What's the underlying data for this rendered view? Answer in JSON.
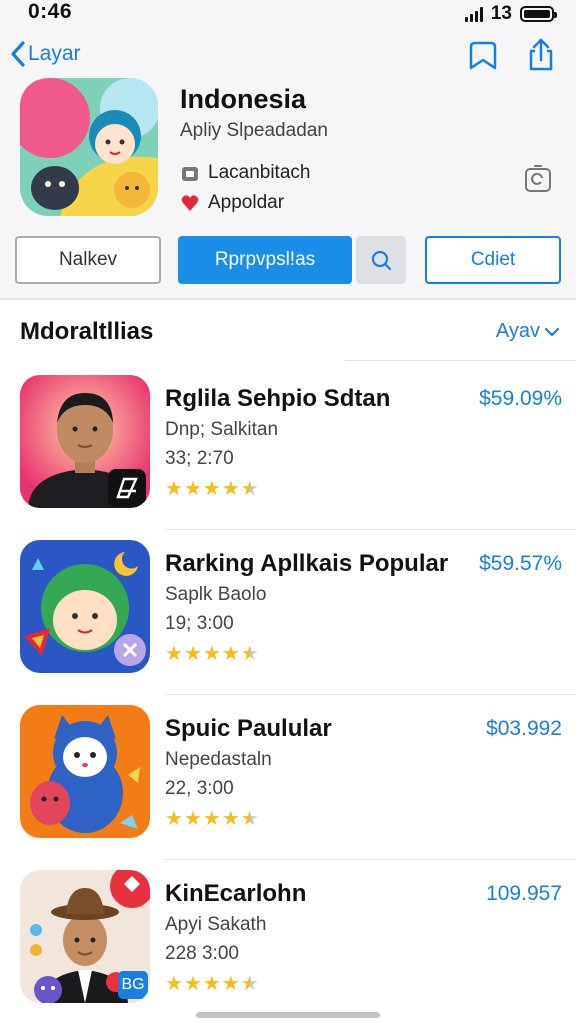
{
  "status_bar": {
    "time": "0:46",
    "signal_label": "13"
  },
  "header": {
    "back_label": "Layar",
    "app_title": "Indonesia",
    "app_subtitle": "Apliy Slpeadadan",
    "meta_1": "Lacanbitach",
    "meta_2": "Appoldar"
  },
  "buttons": {
    "secondary": "Nalkev",
    "primary": "Rprpvpsl!as",
    "tertiary": "Cdiet"
  },
  "section": {
    "title": "Mdoraltllias",
    "action": "Ayav"
  },
  "items": [
    {
      "name": "Rglila Sehpio Sdtan",
      "developer": "Dnp; Salkitan",
      "time": "33; 2:70",
      "price": "$59.09%",
      "rating": 4.5
    },
    {
      "name": "Rarking Apllkais Popular",
      "developer": "Saplk Baolo",
      "time": "19; 3:00",
      "price": "$59.57%",
      "rating": 4.5
    },
    {
      "name": "Spuic Paulular",
      "developer": "Nepedastaln",
      "time": "22, 3:00",
      "price": "$03.992",
      "rating": 4.5
    },
    {
      "name": "KinEcarlohn",
      "developer": "Apyi Sakath",
      "time": "228 3:00",
      "price": "109.957",
      "rating": 4.5
    }
  ],
  "item_badges": {
    "item_4": "BG"
  },
  "colors": {
    "accent": "#1a8de8",
    "link": "#1a7de0",
    "star": "#f3be1a"
  }
}
